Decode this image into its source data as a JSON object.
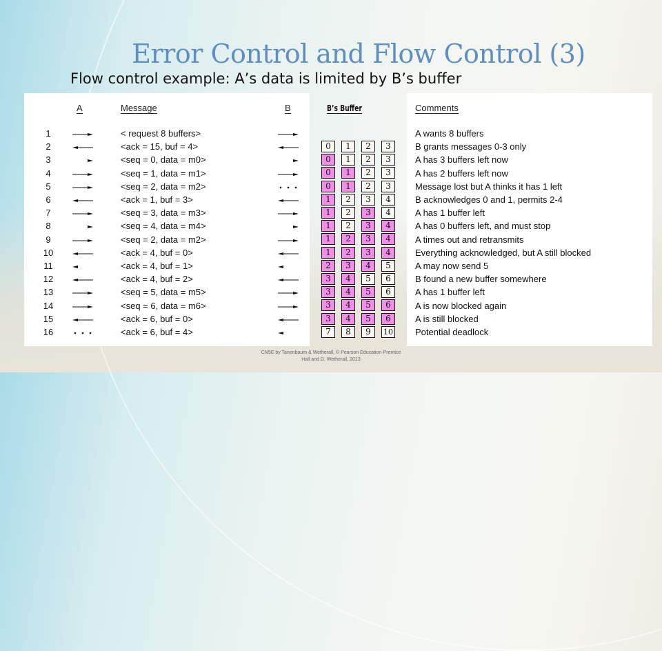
{
  "slide": {
    "title": "Error Control and Flow Control (3)",
    "subtitle": "Flow control example: A’s data is limited by B’s buffer",
    "footer_line1": "CN5E by Tanenbaum & Wetherall, © Pearson Education-Prentice",
    "footer_line2": "Hall and D. Wetherall, 2013"
  },
  "colors": {
    "title": "#5f8fc0",
    "filled_buffer": "#f08ee8"
  },
  "headers": {
    "a": "A",
    "message": "Message",
    "b": "B",
    "buffer": "B’s Buffer",
    "comments": "Comments"
  },
  "rows": [
    {
      "num": "1",
      "a_arrow": "right-arrow",
      "message": "< request 8 buffers>",
      "b_arrow": "right-arrow",
      "comment": "A wants 8 buffers"
    },
    {
      "num": "2",
      "a_arrow": "left-arrow",
      "message": "<ack = 15, buf = 4>",
      "b_arrow": "left-arrow",
      "comment": "B grants messages 0-3 only"
    },
    {
      "num": "3",
      "a_arrow": "right-arrowhead",
      "message": "<seq = 0, data = m0>",
      "b_arrow": "right-arrowhead",
      "comment": "A has 3 buffers left now"
    },
    {
      "num": "4",
      "a_arrow": "right-arrow",
      "message": "<seq = 1, data = m1>",
      "b_arrow": "right-arrow",
      "comment": "A has 2 buffers left now"
    },
    {
      "num": "5",
      "a_arrow": "right-arrow",
      "message": "<seq = 2, data = m2>",
      "b_arrow": "lost-dots",
      "comment": "Message lost but A thinks it has 1 left"
    },
    {
      "num": "6",
      "a_arrow": "left-arrow",
      "message": "<ack = 1, buf = 3>",
      "b_arrow": "left-arrow",
      "comment": "B acknowledges 0 and 1, permits 2-4"
    },
    {
      "num": "7",
      "a_arrow": "right-arrow",
      "message": "<seq = 3, data = m3>",
      "b_arrow": "right-arrow",
      "comment": "A has 1 buffer left"
    },
    {
      "num": "8",
      "a_arrow": "right-arrowhead",
      "message": "<seq = 4, data = m4>",
      "b_arrow": "right-arrowhead",
      "comment": "A has 0 buffers left, and must stop"
    },
    {
      "num": "9",
      "a_arrow": "right-arrow",
      "message": "<seq = 2, data = m2>",
      "b_arrow": "right-arrow",
      "comment": "A times out and retransmits"
    },
    {
      "num": "10",
      "a_arrow": "left-arrow",
      "message": "<ack = 4, buf = 0>",
      "b_arrow": "left-arrow",
      "comment": "Everything acknowledged, but A still blocked"
    },
    {
      "num": "11",
      "a_arrow": "left-arrowhead",
      "message": "<ack = 4, buf = 1>",
      "b_arrow": "left-arrowhead",
      "comment": "A may now send 5"
    },
    {
      "num": "12",
      "a_arrow": "left-arrow",
      "message": "<ack = 4, buf = 2>",
      "b_arrow": "left-arrow",
      "comment": "B found a new buffer somewhere"
    },
    {
      "num": "13",
      "a_arrow": "right-arrow",
      "message": "<seq = 5, data = m5>",
      "b_arrow": "right-arrow",
      "comment": "A has 1 buffer left"
    },
    {
      "num": "14",
      "a_arrow": "right-arrow",
      "message": "<seq = 6, data = m6>",
      "b_arrow": "right-arrow",
      "comment": "A is now blocked again"
    },
    {
      "num": "15",
      "a_arrow": "left-arrow",
      "message": "<ack = 6, buf = 0>",
      "b_arrow": "left-arrow",
      "comment": "A is still blocked"
    },
    {
      "num": "16",
      "a_arrow": "lost-dots",
      "message": "<ack = 6, buf = 4>",
      "b_arrow": "left-arrowhead",
      "comment": "Potential deadlock"
    }
  ],
  "buffer": [
    {
      "values": [
        "0",
        "1",
        "2",
        "3"
      ],
      "filled": [
        false,
        false,
        false,
        false
      ]
    },
    {
      "values": [
        "0",
        "1",
        "2",
        "3"
      ],
      "filled": [
        true,
        false,
        false,
        false
      ]
    },
    {
      "values": [
        "0",
        "1",
        "2",
        "3"
      ],
      "filled": [
        true,
        true,
        false,
        false
      ]
    },
    {
      "values": [
        "0",
        "1",
        "2",
        "3"
      ],
      "filled": [
        true,
        true,
        false,
        false
      ]
    },
    {
      "values": [
        "1",
        "2",
        "3",
        "4"
      ],
      "filled": [
        true,
        false,
        false,
        false
      ]
    },
    {
      "values": [
        "1",
        "2",
        "3",
        "4"
      ],
      "filled": [
        true,
        false,
        true,
        false
      ]
    },
    {
      "values": [
        "1",
        "2",
        "3",
        "4"
      ],
      "filled": [
        true,
        false,
        true,
        true
      ]
    },
    {
      "values": [
        "1",
        "2",
        "3",
        "4"
      ],
      "filled": [
        true,
        true,
        true,
        true
      ]
    },
    {
      "values": [
        "1",
        "2",
        "3",
        "4"
      ],
      "filled": [
        true,
        true,
        true,
        true
      ]
    },
    {
      "values": [
        "2",
        "3",
        "4",
        "5"
      ],
      "filled": [
        true,
        true,
        true,
        false
      ]
    },
    {
      "values": [
        "3",
        "4",
        "5",
        "6"
      ],
      "filled": [
        true,
        true,
        false,
        false
      ]
    },
    {
      "values": [
        "3",
        "4",
        "5",
        "6"
      ],
      "filled": [
        true,
        true,
        true,
        false
      ]
    },
    {
      "values": [
        "3",
        "4",
        "5",
        "6"
      ],
      "filled": [
        true,
        true,
        true,
        true
      ]
    },
    {
      "values": [
        "3",
        "4",
        "5",
        "6"
      ],
      "filled": [
        true,
        true,
        true,
        true
      ]
    },
    {
      "values": [
        "7",
        "8",
        "9",
        "10"
      ],
      "filled": [
        false,
        false,
        false,
        false
      ]
    }
  ]
}
